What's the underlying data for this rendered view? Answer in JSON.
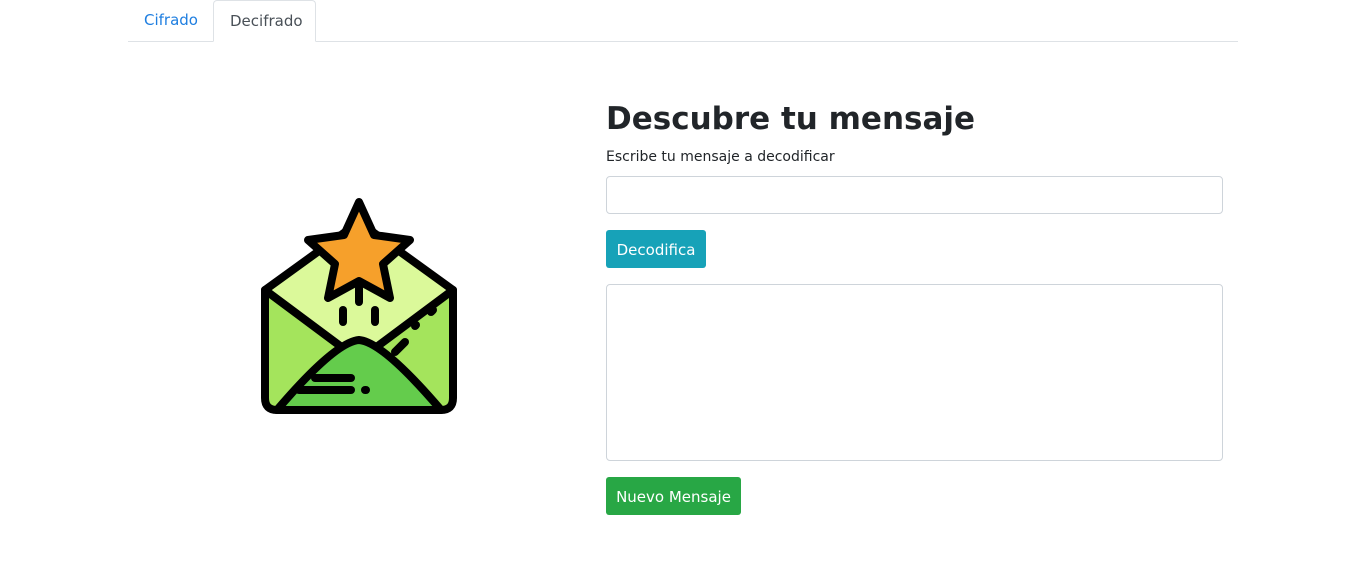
{
  "tabs": [
    {
      "label": "Cifrado",
      "active": false
    },
    {
      "label": "Decifrado",
      "active": true
    }
  ],
  "main": {
    "title": "Descubre tu mensaje",
    "input_label": "Escribe tu mensaje a decodificar",
    "input_value": "",
    "decode_button": "Decodifica",
    "output_value": "",
    "new_message_button": "Nuevo Mensaje"
  },
  "icons": {
    "illustration": "open-envelope-star-icon"
  },
  "colors": {
    "tab_link": "#1e7ee0",
    "decode_button": "#17a2b8",
    "new_message_button": "#28a745",
    "star": "#f6a02b",
    "envelope_light": "#dbf99a",
    "envelope_mid": "#a4e45c",
    "envelope_dark": "#64cc4c"
  }
}
